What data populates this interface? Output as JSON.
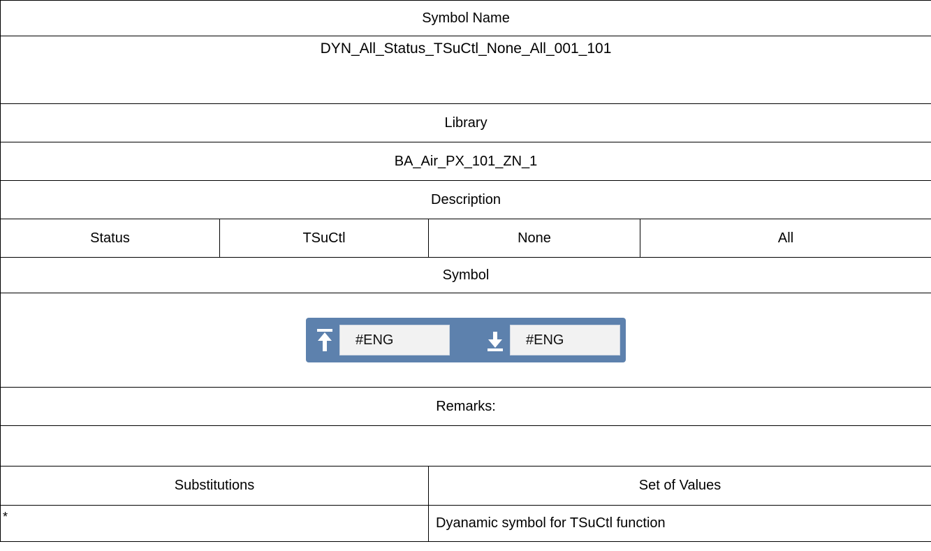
{
  "symbol_name": {
    "header": "Symbol Name",
    "value": "DYN_All_Status_TSuCtl_None_All_001_101"
  },
  "library": {
    "header": "Library",
    "value": "BA_Air_PX_101_ZN_1"
  },
  "description": {
    "header": "Description",
    "cells": [
      "Status",
      "TSuCtl",
      "None",
      "All"
    ]
  },
  "symbol": {
    "header": "Symbol",
    "widget": {
      "background_color": "#5d81ad",
      "left_icon": "arrow-up-to-bar-icon",
      "left_value": "#ENG",
      "right_icon": "arrow-down-to-bar-icon",
      "right_value": "#ENG"
    }
  },
  "remarks": {
    "header": "Remarks:",
    "value": ""
  },
  "substitutions": {
    "header_left": "Substitutions",
    "header_right": "Set of Values",
    "rows": [
      {
        "key": "*",
        "value": "Dyanamic symbol for TSuCtl function"
      }
    ]
  }
}
